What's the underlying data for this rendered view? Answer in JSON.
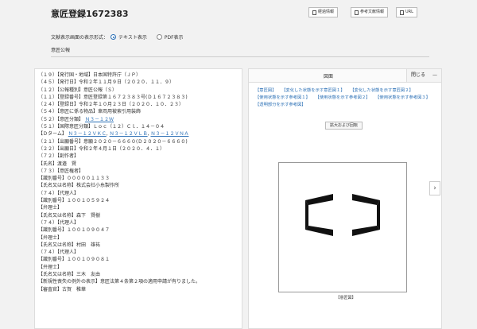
{
  "header": {
    "title": "意匠登録1672383",
    "buttons": [
      "経過情報",
      "参考文献情報",
      "URL"
    ]
  },
  "format": {
    "label": "文献表示画面の表示形式：",
    "options": [
      "テキスト表示",
      "PDF表示"
    ],
    "selected": "テキスト表示"
  },
  "gazette_label": "意匠公報",
  "biblio": {
    "lines": [
      "（１９）【発行国・地域】日本国特許庁（ＪＰ）",
      "（４５）【発行日】令和２年１１月９日（２０２０．１１．９）",
      "（１２）【公報種別】意匠公報（Ｓ）",
      "（１１）【登録番号】意匠登録第１６７２３８３号(Ｄ１６７２３８３)",
      "（２４）【登録日】令和２年１０月２３日（２０２０．１０．２３）",
      "（５４）【意匠に係る物品】車両用被索引用装飾",
      "（５２）【意匠分類】",
      "（５１）【国際意匠分類】Ｌｏｃ（１２）Ｃｌ．１４－０４",
      "【Ｄターム】",
      "（２１）【出願番号】意願２０２０－６６６０(Ｄ２０２０－６６６０)",
      "（２２）【出願日】令和２年４月１日（２０２０．４．１）",
      "（７２）【創作者】",
      "【氏名】渡邉　賢",
      "（７３）【意匠権者】",
      "【識別番号】０００００１１３３",
      "【氏名又は名称】株式会社小糸製作所",
      "（７４）【代理人】",
      "【識別番号】１００１０５９２４",
      "【弁理士】",
      "【氏名又は名称】森下　賢樹",
      "（７４）【代理人】",
      "【識別番号】１００１０９０４７",
      "【弁理士】",
      "【氏名又は名称】村田　雄祐",
      "（７４）【代理人】",
      "【識別番号】１００１０９０８１",
      "【弁理士】",
      "【氏名又は名称】三木　友由",
      "【新規性喪失の例外の表示】意匠法第４条第２項の適用申請が有りました。",
      "【審査官】古賀　稚華"
    ],
    "design_class_link": "Ｎ３－１２Ｗ",
    "dterm_links": [
      "Ｎ３－１２ＶＫＣ",
      "Ｎ３－１２ＶＬＢ",
      "Ｎ３－１２ＶＮＡ"
    ]
  },
  "figure_panel": {
    "title": "図面",
    "close_label": "閉じる",
    "links": [
      "【意匠図】",
      "【変化した状態を示す意匠図１】",
      "【変化した状態を示す意匠図２】",
      "【使用状態を示す参考図１】",
      "【使用状態を示す参考図２】",
      "【使用状態を示す参考図３】",
      "【透明部分を示す参考図】"
    ],
    "zoom_label": "拡大および回転",
    "caption": "【意匠図】"
  }
}
